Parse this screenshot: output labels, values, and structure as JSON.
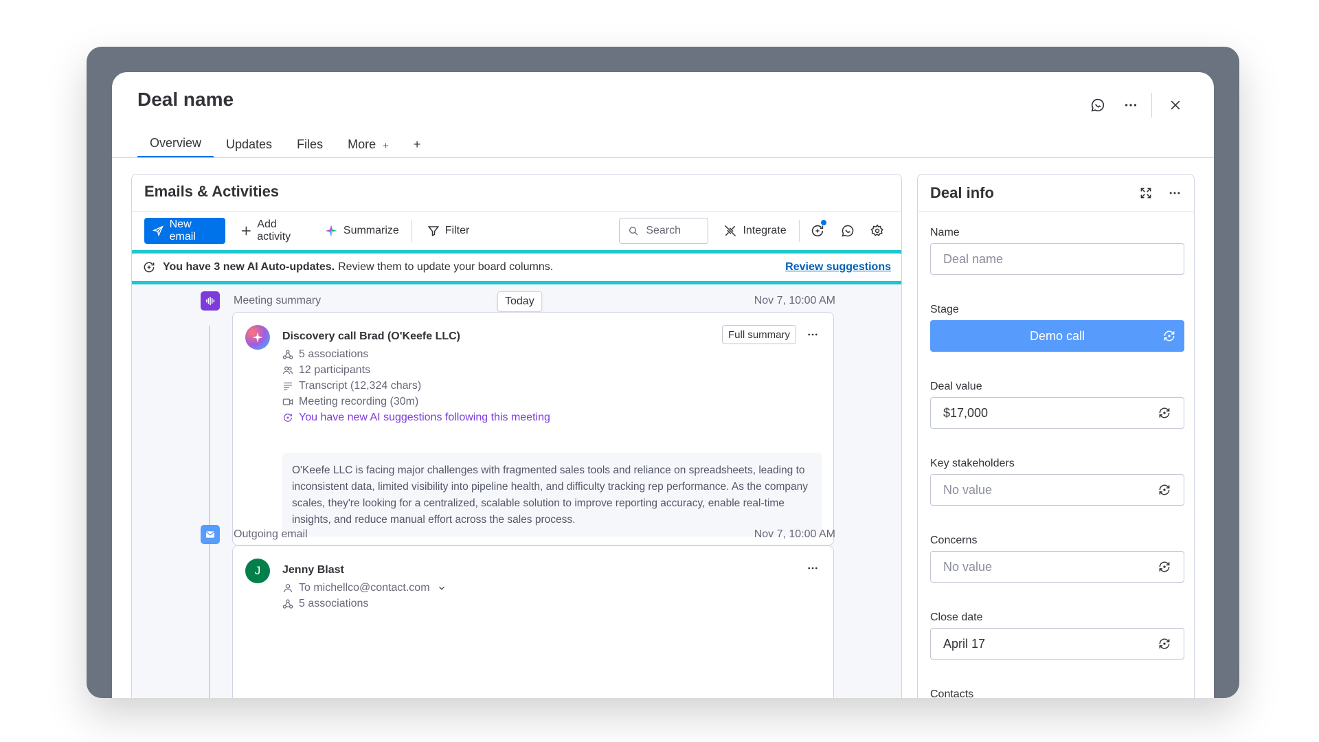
{
  "modal": {
    "title": "Deal name",
    "tabs": [
      {
        "label": "Overview",
        "active": true
      },
      {
        "label": "Updates"
      },
      {
        "label": "Files"
      },
      {
        "label": "More",
        "suffix": "+"
      }
    ],
    "add_tab_label": "+"
  },
  "activities": {
    "title": "Emails & Activities",
    "toolbar": {
      "new_email": "New email",
      "add_activity": "Add activity",
      "summarize": "Summarize",
      "filter": "Filter",
      "search_placeholder": "Search",
      "integrate": "Integrate"
    },
    "ai_banner": {
      "bold": "You have 3 new AI Auto-updates.",
      "text": "Review them to update your board columns.",
      "link": "Review suggestions"
    },
    "today_label": "Today",
    "items": [
      {
        "type_label": "Meeting summary",
        "date": "Nov 7, 10:00 AM",
        "title": "Discovery call Brad (O'Keefe LLC)",
        "summary_button": "Full summary",
        "meta": [
          {
            "icon": "associations-icon",
            "text": "5 associations"
          },
          {
            "icon": "participants-icon",
            "text": "12 participants"
          },
          {
            "icon": "transcript-icon",
            "text": "Transcript (12,324 chars)"
          },
          {
            "icon": "video-icon",
            "text": "Meeting recording (30m)"
          },
          {
            "icon": "ai-sync-icon",
            "text": "You have new AI suggestions following this meeting"
          }
        ],
        "summary": "O'Keefe LLC is facing major challenges with fragmented sales tools and reliance on spreadsheets, leading to inconsistent data, limited visibility into pipeline health, and difficulty tracking rep performance. As the company scales, they're looking for a centralized, scalable solution to improve reporting accuracy, enable real-time insights, and reduce manual effort across the sales process."
      },
      {
        "type_label": "Outgoing email",
        "date": "Nov 7, 10:00 AM",
        "sender": "Jenny Blast",
        "avatar_letter": "J",
        "to": "To michellco@contact.com",
        "associations": "5 associations"
      }
    ]
  },
  "deal_info": {
    "title": "Deal info",
    "fields": {
      "name_label": "Name",
      "name_placeholder": "Deal name",
      "stage_label": "Stage",
      "stage_value": "Demo call",
      "value_label": "Deal value",
      "value_value": "$17,000",
      "stakeholders_label": "Key stakeholders",
      "stakeholders_value": "No value",
      "concerns_label": "Concerns",
      "concerns_value": "No value",
      "close_label": "Close date",
      "close_value": "April 17",
      "contacts_label": "Contacts"
    }
  },
  "colors": {
    "primary": "#0073ea",
    "stage": "#579bfc",
    "highlight": "#1ec6cf",
    "ai_purple": "#7e3bdc",
    "meeting_icon_bg": "#7e3bdc",
    "email_icon_bg": "#579bfc",
    "avatar_green": "#037f4c"
  }
}
